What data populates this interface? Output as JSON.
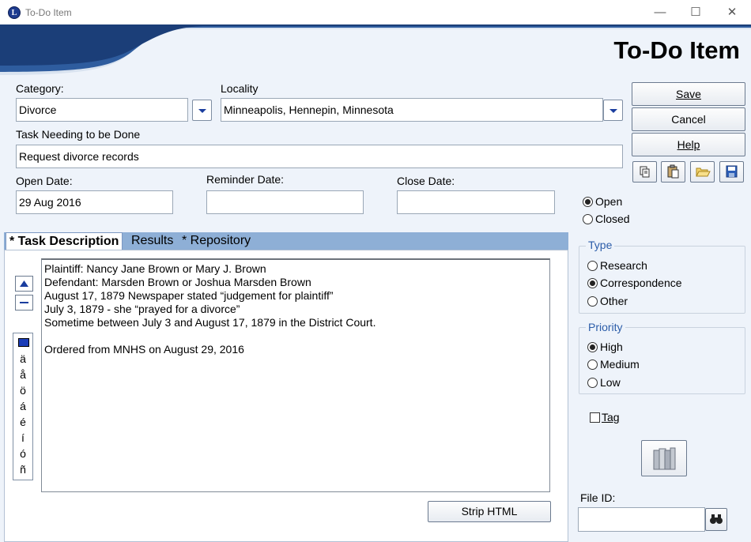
{
  "window": {
    "title": "To-Do Item",
    "minimize_glyph": "—",
    "maximize_glyph": "☐",
    "close_glyph": "✕",
    "app_icon_letter": "L"
  },
  "header": {
    "title": "To-Do Item"
  },
  "category": {
    "label": "Category:",
    "value": "Divorce"
  },
  "locality": {
    "label": "Locality",
    "value": "Minneapolis, Hennepin, Minnesota"
  },
  "task": {
    "label": "Task Needing to be Done",
    "value": "Request divorce records"
  },
  "open_date": {
    "label": "Open Date:",
    "value": "29 Aug 2016"
  },
  "reminder_date": {
    "label": "Reminder Date:",
    "value": ""
  },
  "close_date": {
    "label": "Close Date:",
    "value": ""
  },
  "buttons": {
    "save": "Save",
    "cancel": "Cancel",
    "help": "Help",
    "strip_html": "Strip HTML"
  },
  "status": {
    "open": "Open",
    "closed": "Closed",
    "selected": "Open"
  },
  "type_group": {
    "title": "Type",
    "options": [
      "Research",
      "Correspondence",
      "Other"
    ],
    "selected": "Correspondence"
  },
  "priority_group": {
    "title": "Priority",
    "options": [
      "High",
      "Medium",
      "Low"
    ],
    "selected": "High"
  },
  "tag": {
    "label": "Tag",
    "checked": false
  },
  "file_id": {
    "label": "File ID:",
    "value": ""
  },
  "tabs": [
    {
      "label": "* Task Description",
      "active": true
    },
    {
      "label": "Results",
      "active": false
    },
    {
      "label": "* Repository",
      "active": false
    }
  ],
  "description_lines": [
    "Plaintiff: Nancy Jane Brown or Mary J. Brown",
    "Defendant: Marsden Brown or Joshua Marsden Brown",
    "August 17, 1879 Newspaper stated “judgement for plaintiff”",
    "July 3, 1879 - she “prayed for a divorce”",
    "Sometime between July 3 and August 17, 1879 in the District Court.",
    "",
    "Ordered from MNHS on August 29, 2016"
  ],
  "special_chars": [
    "ä",
    "å",
    "ö",
    "á",
    "é",
    "í",
    "ó",
    "ñ"
  ],
  "colors": {
    "accent_blue": "#1a3d9e",
    "tab_strip": "#8eafd6",
    "group_title": "#2c5da9",
    "form_bg": "#eef3fa"
  },
  "icons": [
    "copy-icon",
    "paste-icon",
    "open-folder-icon",
    "save-disk-icon",
    "books-icon",
    "binoculars-icon",
    "color-swatch-icon"
  ]
}
